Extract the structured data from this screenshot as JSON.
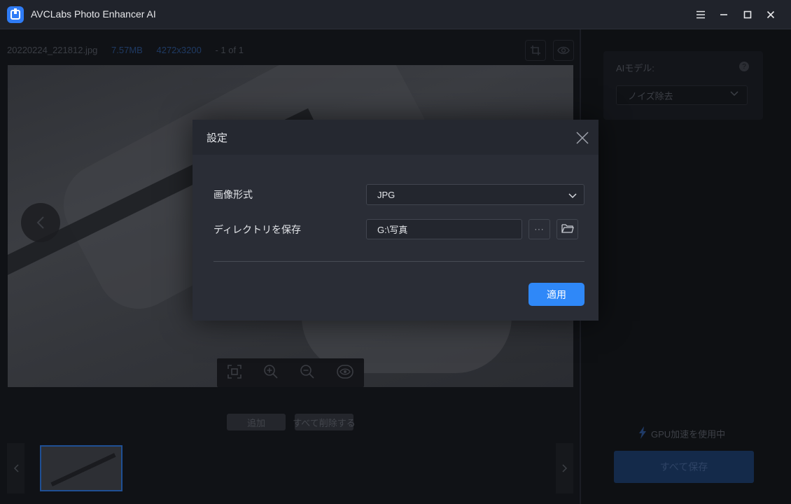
{
  "app": {
    "title": "AVCLabs Photo Enhancer AI"
  },
  "file_info": {
    "name": "20220224_221812.jpg",
    "size": "7.57MB",
    "resolution": "4272x3200",
    "counter": "- 1 of 1"
  },
  "bottom": {
    "add_label": "追加",
    "delete_all_label": "すべて削除する"
  },
  "right_panel": {
    "model_label": "AIモデル:",
    "model_value": "ノイズ除去",
    "gpu_status": "GPU加速を使用中",
    "save_all_label": "すべて保存"
  },
  "modal": {
    "title": "設定",
    "format_label": "画像形式",
    "format_value": "JPG",
    "dir_label": "ディレクトリを保存",
    "dir_value": "G:\\写真",
    "browse_label": "···",
    "apply_label": "適用"
  },
  "colors": {
    "accent": "#2f88f8",
    "modal_bg": "#2a2d36"
  }
}
